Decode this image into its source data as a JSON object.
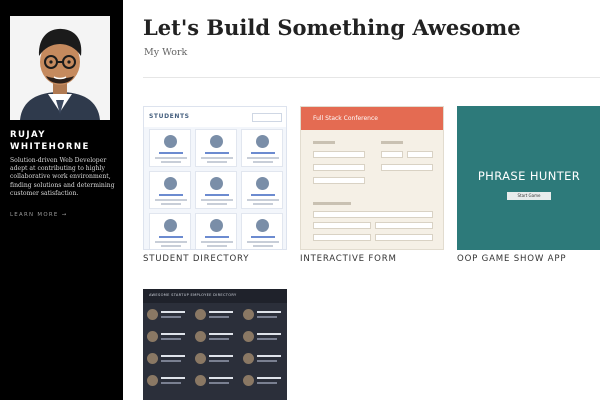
{
  "profile": {
    "name": "RUJAY WHITEHORNE",
    "bio": "Solution-driven Web Developer adept at contributing to highly collaborative work environment, finding solutions and determining customer satisfaction.",
    "learn_more": "LEARN MORE →"
  },
  "main": {
    "title": "Let's Build Something Awesome",
    "subtitle": "My Work"
  },
  "projects": [
    {
      "caption": "STUDENT DIRECTORY",
      "header": "STUDENTS"
    },
    {
      "caption": "INTERACTIVE FORM",
      "header": "Full Stack Conference"
    },
    {
      "caption": "OOP GAME SHOW APP",
      "header": "PHRASE HUNTER",
      "button": "Start Game"
    },
    {
      "caption": "",
      "header": "AWESOME STARTUP EMPLOYEE DIRECTORY"
    }
  ],
  "colors": {
    "sidebar": "#000000",
    "form_accent": "#e46b52",
    "game_bg": "#2d7a7a",
    "employee_bg": "#2b2f3a"
  }
}
